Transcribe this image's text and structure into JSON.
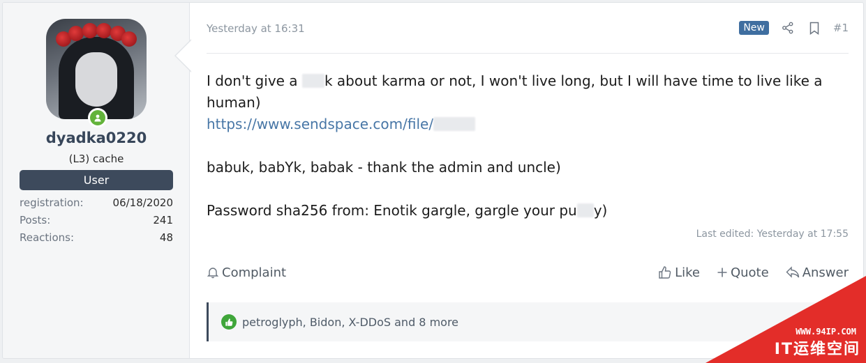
{
  "user": {
    "username": "dyadka0220",
    "title": "(L3) cache",
    "banner": "User",
    "stats": [
      {
        "label": "registration:",
        "value": "06/18/2020"
      },
      {
        "label": "Posts:",
        "value": "241"
      },
      {
        "label": "Reactions:",
        "value": "48"
      }
    ]
  },
  "post": {
    "date": "Yesterday at 16:31",
    "new_badge": "New",
    "number": "#1",
    "line1_a": "I don't give a ",
    "line1_b": "k about karma or not, I won't live long, but I will have time to live like a human)",
    "link": "https://www.sendspace.com/file/",
    "line3": "babuk, babYk, babak - thank the admin and uncle)",
    "line4_a": "Password sha256 from: Enotik gargle, gargle your pu",
    "line4_b": "y)",
    "edited": "Last edited: Yesterday at 17:55"
  },
  "actions": {
    "complaint": "Complaint",
    "like": "Like",
    "quote": "Quote",
    "answer": "Answer"
  },
  "reactions": {
    "text": "petroglyph, Bidon, X-DDoS and 8 more"
  },
  "watermark": {
    "url": "WWW.94IP.COM",
    "text": "IT运维空间"
  },
  "colors": {
    "accent": "#3d4a5c",
    "link": "#4776a6",
    "online": "#63b33b",
    "new_badge": "#3f6ea0",
    "watermark": "#e32d29"
  }
}
